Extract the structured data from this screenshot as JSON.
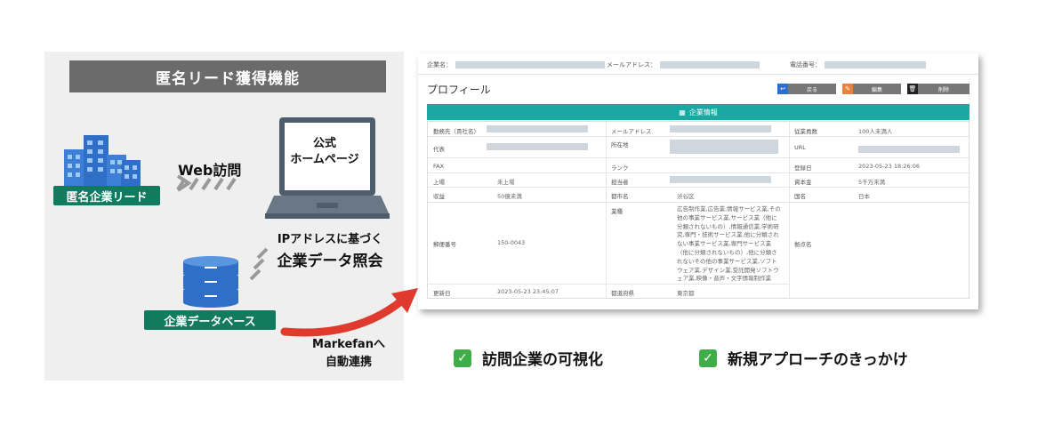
{
  "left": {
    "title": "匿名リード獲得機能",
    "anon_lead_label": "匿名企業リード",
    "web_visit": "Web訪問",
    "laptop_line1": "公式",
    "laptop_line2": "ホームページ",
    "ip_line1": "IPアドレスに基づく",
    "ip_line2": "企業データ照会",
    "db_label": "企業データベース",
    "mk_line1": "Markefanへ",
    "mk_line2": "自動連携"
  },
  "screen": {
    "topbar": {
      "company_label": "企業名：",
      "email_label": "メールアドレス：",
      "phone_label": "電話番号："
    },
    "profile_title": "プロフィール",
    "buttons": {
      "back": "戻る",
      "edit": "編集",
      "delete": "削除"
    },
    "section_title": "企業情報",
    "fields": {
      "employer": "勤務先（貴社名）",
      "representative": "代表",
      "fax": "FAX",
      "listing": "上場",
      "listing_value": "未上場",
      "revenue": "収益",
      "revenue_value": "50億未満",
      "postal": "郵便番号",
      "postal_value": "150-0043",
      "updated": "更新日",
      "updated_value": "2023-05-23 23:45:07",
      "email": "メールアドレス",
      "address": "所在地",
      "rank": "ランク",
      "person": "担当者",
      "city": "都市名",
      "city_value": "渋谷区",
      "industry": "業種",
      "industry_value": "広告制作業,広告業,情報サービス業,その他の事業サービス業,サービス業（他に分類されないもの）,情報通信業,学術研究,専門・技術サービス業,他に分類されない事業サービス業,専門サービス業（他に分類されないもの）,他に分類されないその他の事業サービス業,ソフトウェア業,デザイン業,受託開発ソフトウェア業,映像・音声・文字情報制作業",
      "prefecture": "都道府県",
      "prefecture_value": "東京都",
      "employees": "従業員数",
      "employees_value": "100人未満人",
      "url": "URL",
      "registered": "登録日",
      "registered_value": "2023-05-23 18:26:06",
      "capital": "資本金",
      "capital_value": "5千万未満",
      "country": "国名",
      "country_value": "日本",
      "base": "拠点名"
    }
  },
  "features": {
    "f1": "訪問企業の可視化",
    "f2": "新規アプローチのきっかけ"
  },
  "colors": {
    "teal": "#17a9a2",
    "green": "#127a5e",
    "red_arrow": "#e03a2f",
    "check_green": "#3fae49"
  }
}
